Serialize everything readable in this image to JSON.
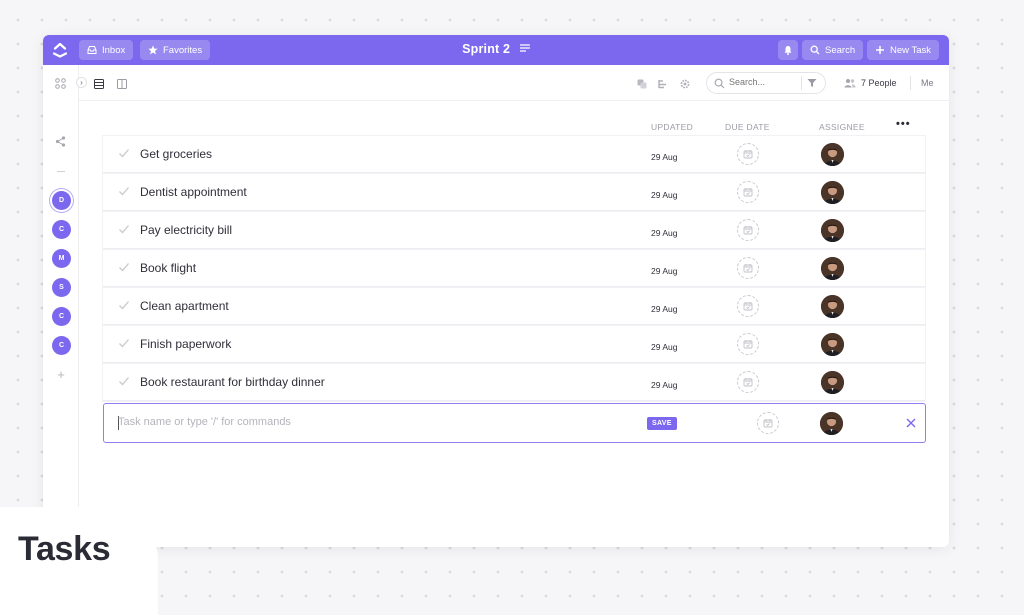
{
  "topbar": {
    "inbox_label": "Inbox",
    "favorites_label": "Favorites",
    "title": "Sprint 2",
    "search_label": "Search",
    "new_task_label": "New Task",
    "accent": "#7b68ee"
  },
  "toolbar": {
    "search_placeholder": "Search...",
    "people_label": "7 People",
    "me_label": "Me"
  },
  "sidebar": {
    "avatars": [
      "D",
      "C",
      "M",
      "S",
      "C",
      "C"
    ],
    "add_symbol": "+"
  },
  "columns": {
    "updated": "UPDATED",
    "due_date": "DUE DATE",
    "assignee": "ASSIGNEE",
    "more": "•••"
  },
  "tasks": [
    {
      "name": "Get groceries",
      "updated": "29 Aug"
    },
    {
      "name": "Dentist appointment",
      "updated": "29 Aug"
    },
    {
      "name": "Pay electricity bill",
      "updated": "29 Aug"
    },
    {
      "name": "Book flight",
      "updated": "29 Aug"
    },
    {
      "name": "Clean apartment",
      "updated": "29 Aug"
    },
    {
      "name": "Finish paperwork",
      "updated": "29 Aug"
    },
    {
      "name": "Book restaurant for birthday dinner",
      "updated": "29 Aug"
    }
  ],
  "new_task": {
    "placeholder": "Task name or type '/' for commands",
    "save_label": "SAVE"
  },
  "caption": "Tasks"
}
